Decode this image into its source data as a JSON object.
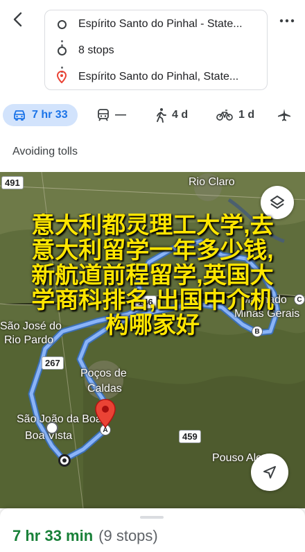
{
  "route": {
    "origin": "Espírito Santo do Pinhal - State...",
    "stops": "8 stops",
    "destination": "Espírito Santo do Pinhal, State..."
  },
  "modes": {
    "drive": "7 hr 33",
    "transit": "—",
    "walk": "4 d",
    "bike": "1 d"
  },
  "avoid_label": "Avoiding tolls",
  "map": {
    "labels": {
      "rio_claro": "Rio Claro",
      "sao_jose": "São José do",
      "rio_pardo": "Rio Pardo",
      "pocos": "Poços de",
      "caldas": "Caldas",
      "sao_joao": "São João da Boa",
      "boa_vista": "Boa Vista",
      "pouso_alegre": "Pouso Alegre",
      "machado": "Machado",
      "minas_gerais": "Minas Gerais"
    },
    "road_signs": {
      "r491": "491",
      "r146": "146",
      "r267": "267",
      "r459": "459"
    },
    "stop_letters": {
      "a": "A",
      "b": "B",
      "c": "C"
    },
    "overlay_lines": [
      "意大利都灵理工大学,去",
      "意大利留学一年多少钱,",
      "新航道前程留学,英国大",
      "学商科排名,出国中介机",
      "构哪家好"
    ]
  },
  "summary": {
    "time": "7 hr 33 min",
    "stops": "(9 stops)"
  },
  "colors": {
    "accent": "#1a73e8",
    "route": "#8ab4f8",
    "time_green": "#188038",
    "pin_red": "#ea4335"
  }
}
